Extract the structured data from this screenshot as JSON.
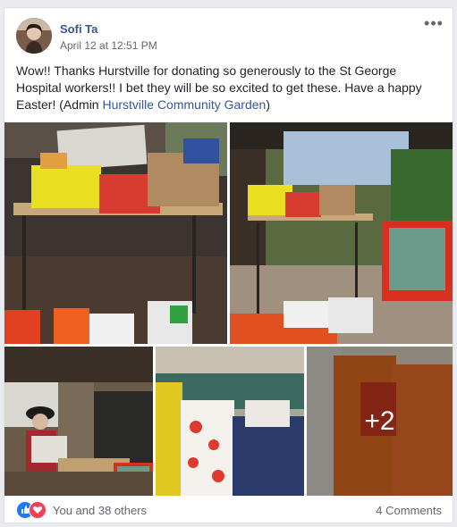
{
  "post": {
    "author": "Sofi Ta",
    "timestamp": "April 12 at 12:51 PM",
    "more_menu": "•••",
    "text_main": "Wow!! Thanks Hurstville for donating so generously to the St George Hospital workers!! I bet they will be so excited to get these. Have a happy Easter! (Admin ",
    "text_link": "Hurstville Community Garden",
    "text_end": ")"
  },
  "photos": {
    "extra_count": "+2"
  },
  "footer": {
    "reactions": [
      "like-icon",
      "love-icon"
    ],
    "reactors": "You and 38 others",
    "comments": "4 Comments"
  },
  "colors": {
    "link": "#365899",
    "like": "#2078f4",
    "love": "#f33e58"
  }
}
